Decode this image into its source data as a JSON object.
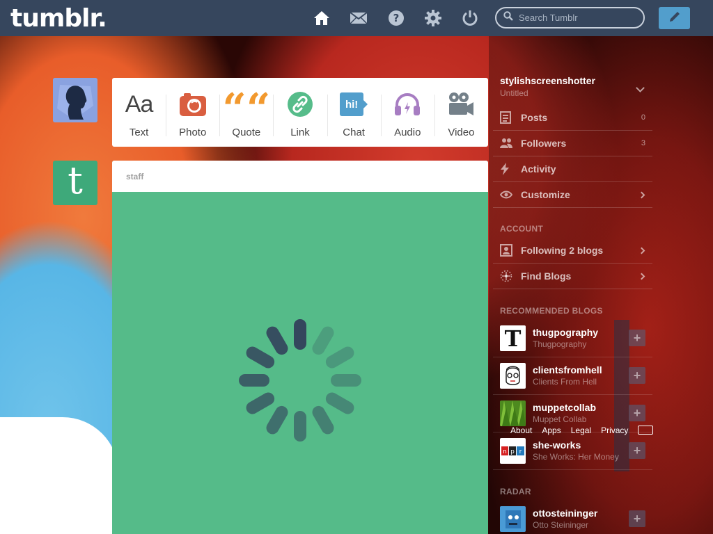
{
  "header": {
    "logo": "tumblr.",
    "search_placeholder": "Search Tumblr",
    "nav_icons": [
      "home-icon",
      "mail-icon",
      "help-icon",
      "settings-icon",
      "power-icon"
    ],
    "compose_icon": "pencil-icon"
  },
  "post_types": [
    {
      "label": "Text",
      "icon": "text-icon",
      "glyph": "Aa",
      "color": "#444444"
    },
    {
      "label": "Photo",
      "icon": "camera-icon",
      "color": "#d95e40"
    },
    {
      "label": "Quote",
      "icon": "quote-icon",
      "glyph": "““",
      "color": "#f2992e"
    },
    {
      "label": "Link",
      "icon": "link-icon",
      "color": "#56bc8a"
    },
    {
      "label": "Chat",
      "icon": "chat-icon",
      "glyph": "hi!",
      "color": "#529ecc"
    },
    {
      "label": "Audio",
      "icon": "headphones-icon",
      "color": "#a77dc2"
    },
    {
      "label": "Video",
      "icon": "video-camera-icon",
      "color": "#748089"
    }
  ],
  "post": {
    "author": "staff",
    "background_color": "#55bb89"
  },
  "sidebar": {
    "blog_name": "stylishscreenshotter",
    "blog_title": "Untitled",
    "items": [
      {
        "label": "Posts",
        "icon": "posts-icon",
        "count": "0"
      },
      {
        "label": "Followers",
        "icon": "followers-icon",
        "count": "3"
      },
      {
        "label": "Activity",
        "icon": "activity-icon"
      },
      {
        "label": "Customize",
        "icon": "eye-icon"
      }
    ],
    "account_heading": "ACCOUNT",
    "account_items": [
      {
        "label": "Following 2 blogs",
        "icon": "following-icon"
      },
      {
        "label": "Find Blogs",
        "icon": "compass-icon"
      }
    ],
    "recommended_heading": "RECOMMENDED BLOGS",
    "recommended": [
      {
        "name": "thugpography",
        "title": "Thugpography"
      },
      {
        "name": "clientsfromhell",
        "title": "Clients From Hell"
      },
      {
        "name": "muppetcollab",
        "title": "Muppet Collab"
      },
      {
        "name": "she-works",
        "title": "She Works: Her Money"
      }
    ],
    "footer_links": [
      "About",
      "Apps",
      "Legal",
      "Privacy"
    ],
    "radar_heading": "RADAR",
    "radar": [
      {
        "name": "ottosteininger",
        "title": "Otto Steininger"
      }
    ]
  }
}
